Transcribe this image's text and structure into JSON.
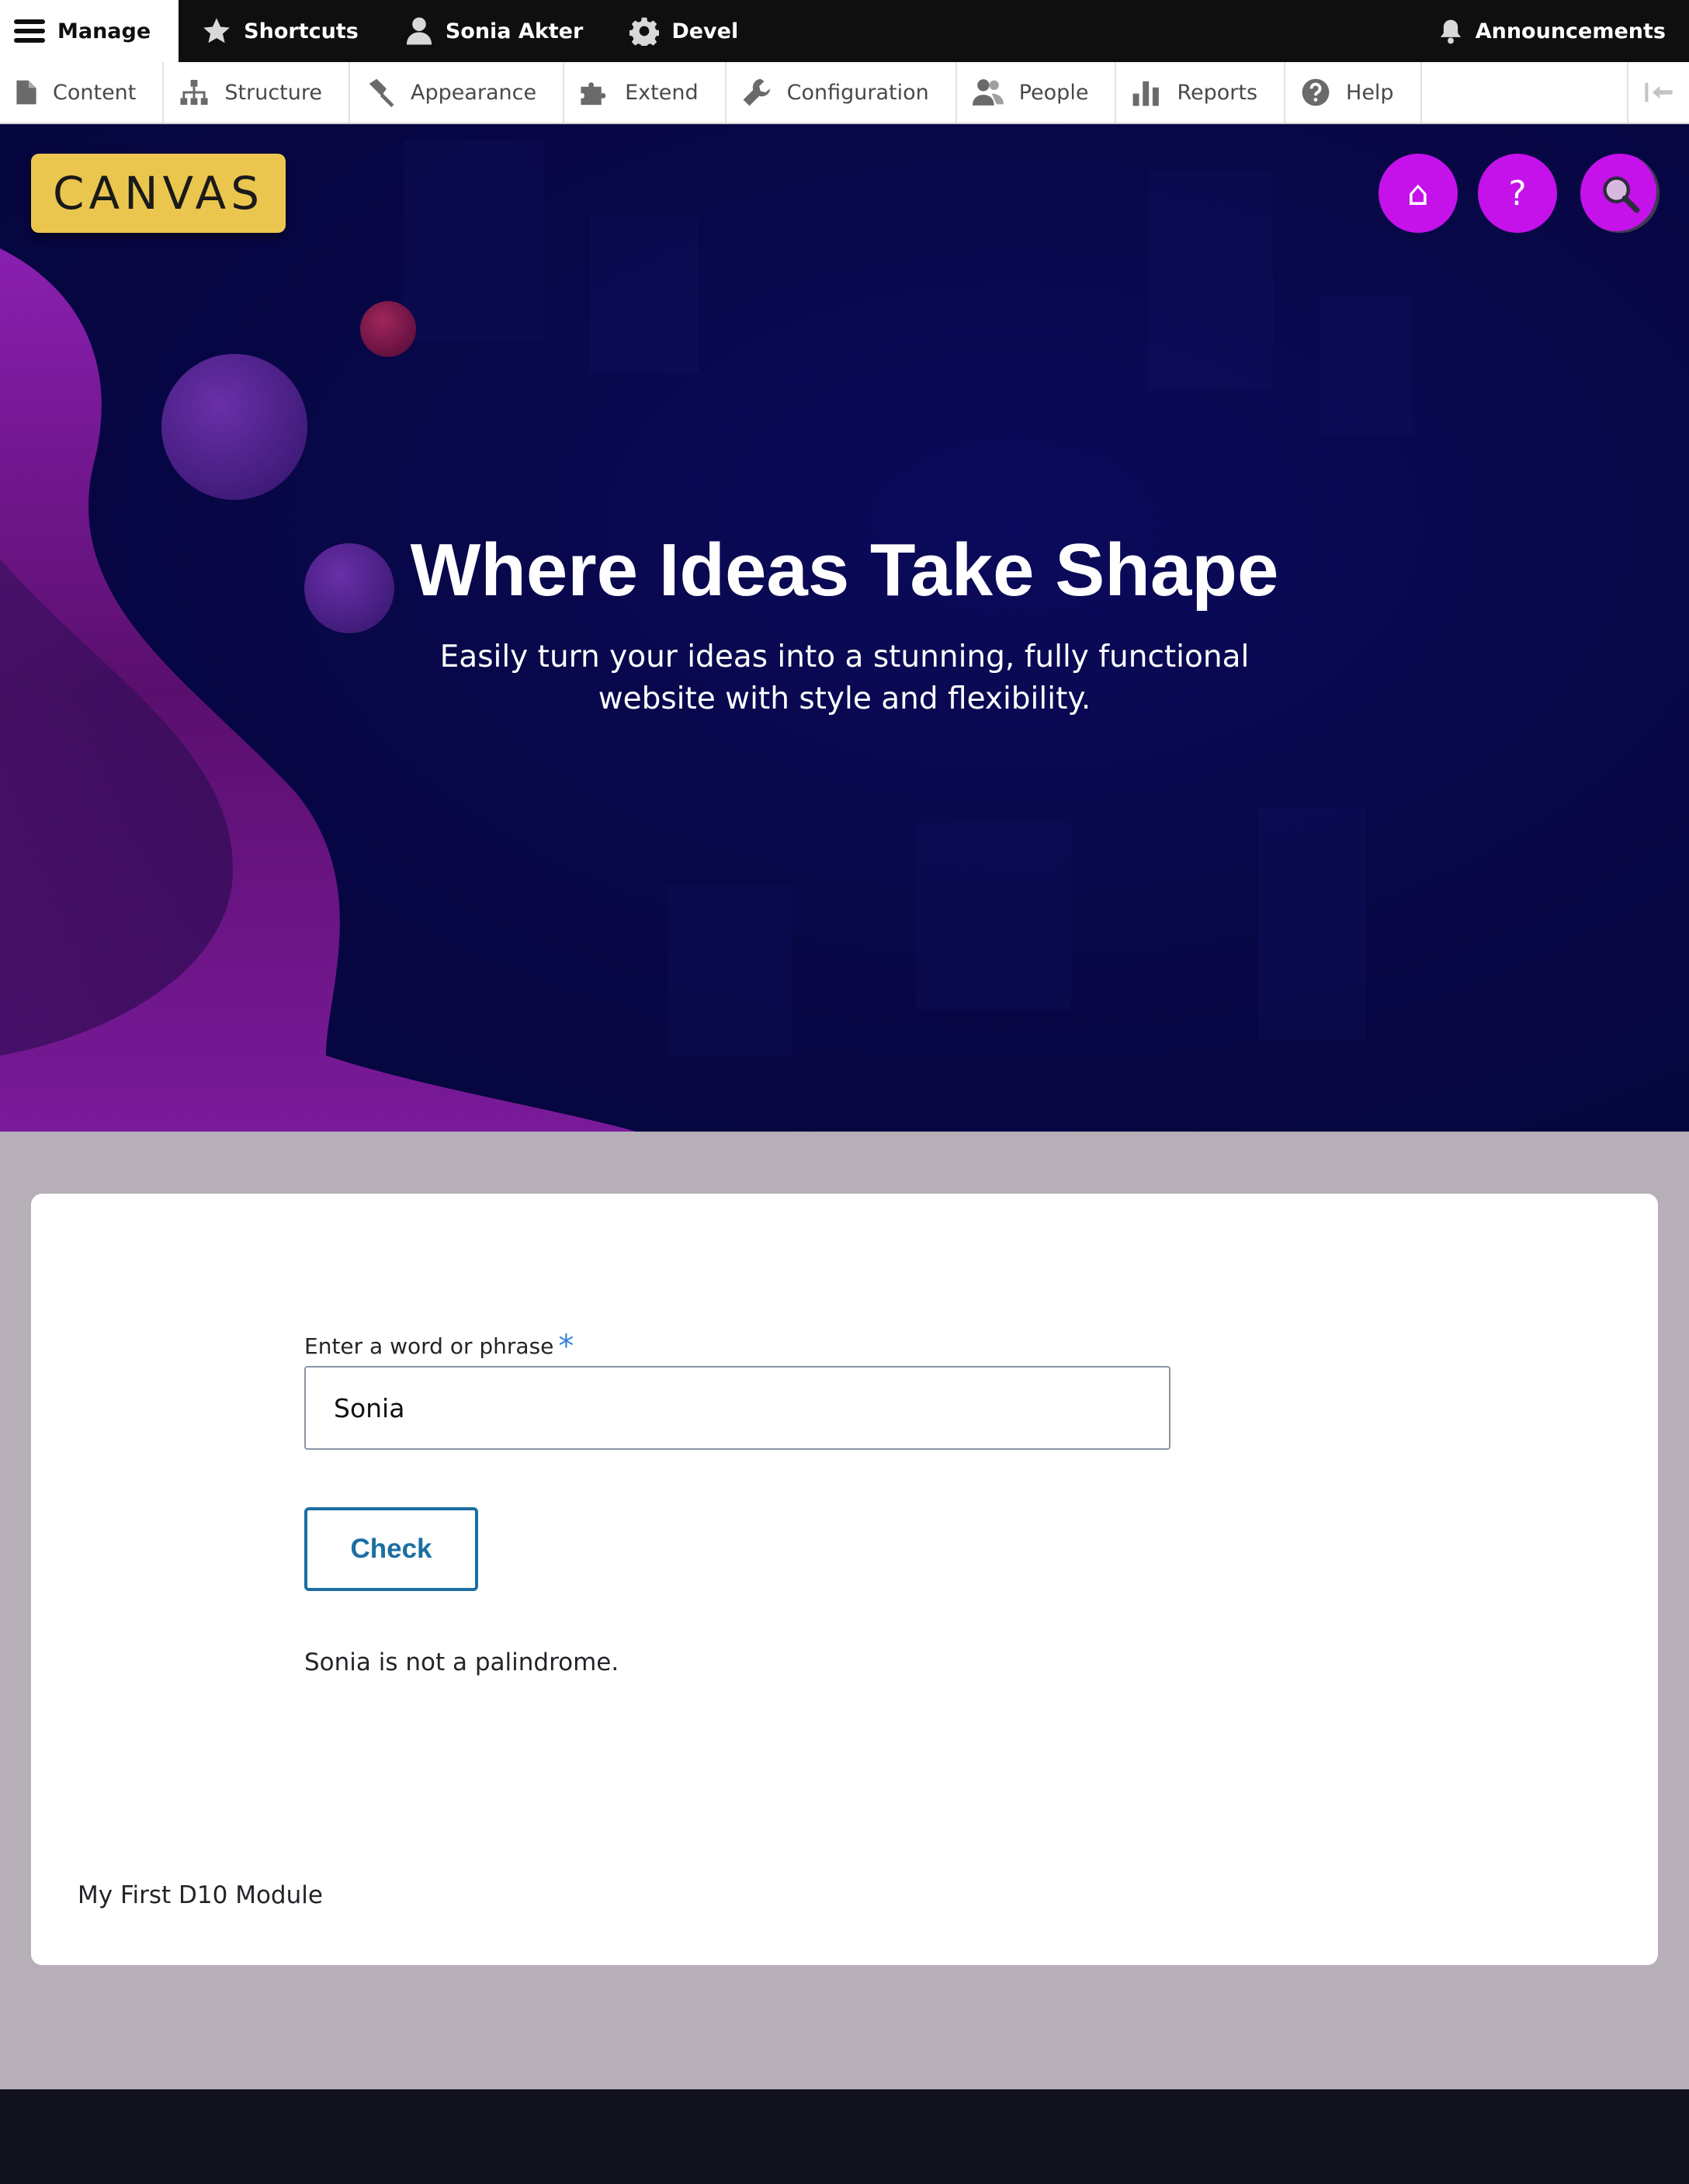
{
  "toolbar": {
    "manage_label": "Manage",
    "shortcuts_label": "Shortcuts",
    "user_label": "Sonia Akter",
    "devel_label": "Devel",
    "announcements_label": "Announcements"
  },
  "tray": {
    "items": [
      {
        "label": "Content",
        "icon": "file-icon"
      },
      {
        "label": "Structure",
        "icon": "sitemap-icon"
      },
      {
        "label": "Appearance",
        "icon": "paintbrush-icon"
      },
      {
        "label": "Extend",
        "icon": "puzzle-icon"
      },
      {
        "label": "Configuration",
        "icon": "wrench-icon"
      },
      {
        "label": "People",
        "icon": "people-icon"
      },
      {
        "label": "Reports",
        "icon": "bar-chart-icon"
      },
      {
        "label": "Help",
        "icon": "question-circle-icon"
      }
    ]
  },
  "hero": {
    "logo_text": "CANVAS",
    "home_icon": "⌂",
    "help_icon": "?",
    "title": "Where Ideas Take Shape",
    "subtitle": "Easily turn your ideas into a stunning, fully functional website with style and flexibility."
  },
  "form": {
    "label": "Enter a word or phrase",
    "required_mark": "*",
    "input_value": "Sonia",
    "button_label": "Check",
    "result": "Sonia is not a palindrome."
  },
  "card_footer": "My First D10 Module",
  "colors": {
    "accent_button": "#c511ea",
    "logo_badge": "#ebc64f",
    "link_blue": "#1b6ea3",
    "hero_bg": "#080748",
    "page_bg": "#b6afb8",
    "footer_bg": "#12131e"
  }
}
